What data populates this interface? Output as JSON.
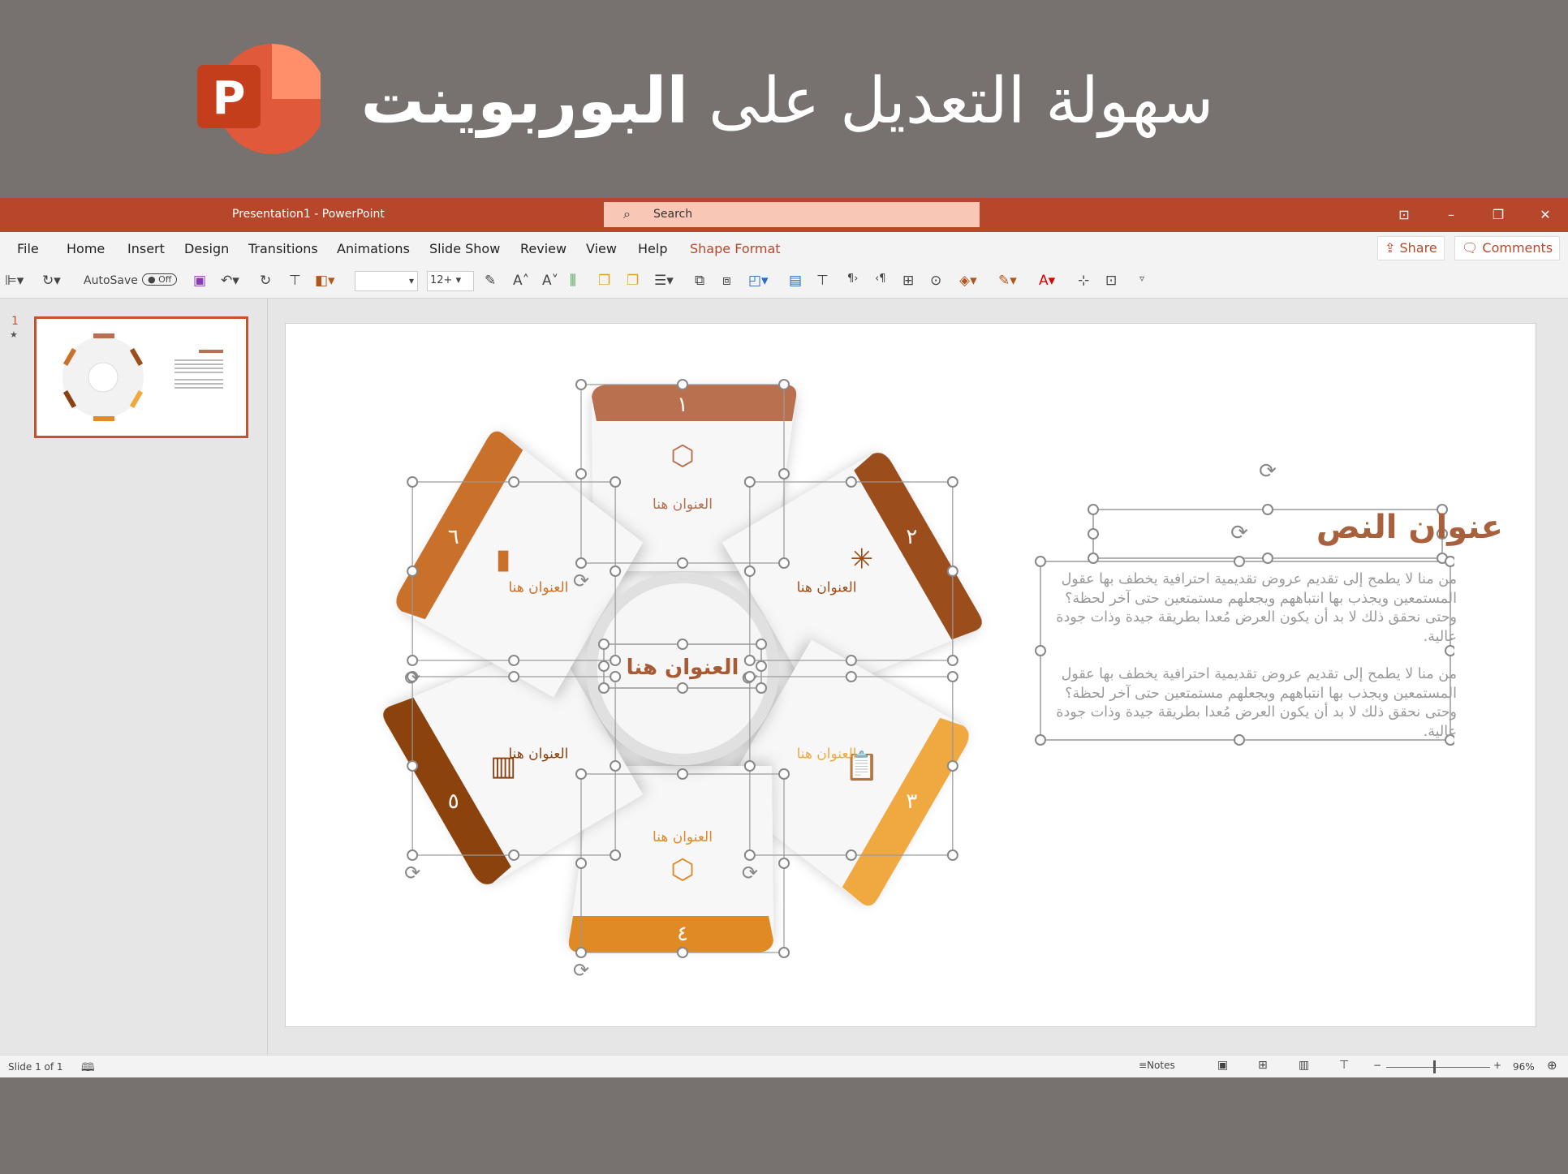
{
  "banner": {
    "headline_light": "سهولة التعديل على",
    "headline_bold": "البوربوينت",
    "logo_letter": "P"
  },
  "titlebar": {
    "doc_title": "Presentation1  -  PowerPoint",
    "search_placeholder": "Search",
    "accent": "#b7472a"
  },
  "menu": {
    "items": [
      "File",
      "Home",
      "Insert",
      "Design",
      "Transitions",
      "Animations",
      "Slide Show",
      "Review",
      "View",
      "Help",
      "Shape Format"
    ],
    "share": "Share",
    "comments": "Comments"
  },
  "toolbar": {
    "autosave": "AutoSave",
    "autosave_state": "Off",
    "font_name": "",
    "font_size": "12+"
  },
  "thumbnails": [
    {
      "number": "1",
      "star": "★"
    }
  ],
  "slide": {
    "center_label": "العنوان هنا",
    "segments": [
      {
        "number": "١",
        "label": "العنوان هنا",
        "color": "#b8704f",
        "icon": "cubes-icon"
      },
      {
        "number": "٢",
        "label": "العنوان هنا",
        "color": "#9c4e1a",
        "icon": "network-icon"
      },
      {
        "number": "٣",
        "label": "العنوان هنا",
        "color": "#f0a840",
        "icon": "clipboard-icon"
      },
      {
        "number": "٤",
        "label": "العنوان هنا",
        "color": "#e08a28",
        "icon": "cubes-icon"
      },
      {
        "number": "٥",
        "label": "العنوان هنا",
        "color": "#8b4210",
        "icon": "barcode-icon"
      },
      {
        "number": "٦",
        "label": "العنوان هنا",
        "color": "#c9702a",
        "icon": "bar-chart-icon"
      }
    ],
    "text_title": "عنوان النص",
    "paragraphs": [
      "من منا لا يطمح إلى تقديم عروض تقديمية احترافية يخطف بها عقول المستمعين ويجذب بها انتباههم ويجعلهم مستمتعين حتى آخر لحظة؟ وحتى نحقق ذلك لا بد أن يكون العرض مُعدا بطريقة جيدة وذات جودة عالية.",
      "من منا لا يطمح إلى تقديم عروض تقديمية احترافية يخطف بها عقول المستمعين ويجذب بها انتباههم ويجعلهم مستمتعين حتى آخر لحظة؟ وحتى نحقق ذلك لا بد أن يكون العرض مُعدا بطريقة جيدة وذات جودة عالية."
    ]
  },
  "status": {
    "slide_count": "Slide 1 of 1",
    "notes": "Notes",
    "zoom": "96%",
    "zoom_minus": "−",
    "zoom_plus": "+"
  }
}
